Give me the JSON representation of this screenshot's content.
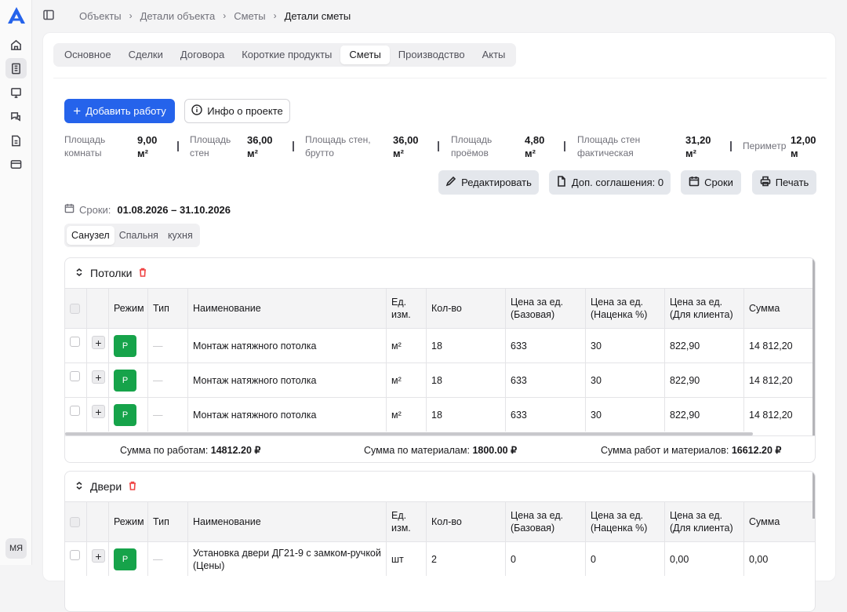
{
  "nav": {
    "avatar": "МЯ"
  },
  "breadcrumb": [
    "Объекты",
    "Детали объекта",
    "Сметы",
    "Детали сметы"
  ],
  "tabs": [
    "Основное",
    "Сделки",
    "Договора",
    "Короткие продукты",
    "Сметы",
    "Производство",
    "Акты"
  ],
  "active_tab": "Сметы",
  "buttons": {
    "add_work": "Добавить работу",
    "project_info": "Инфо о проекте",
    "edit": "Редактировать",
    "addenda": "Доп. соглашения: 0",
    "deadlines": "Сроки",
    "print": "Печать"
  },
  "metrics": [
    {
      "label_1": "Площадь",
      "label_2": "комнаты",
      "val_1": "9,00",
      "val_2": "м²"
    },
    {
      "label_1": "Площадь",
      "label_2": "стен",
      "val_1": "36,00",
      "val_2": "м²"
    },
    {
      "label_1": "Площадь стен,",
      "label_2": "брутто",
      "val_1": "36,00",
      "val_2": "м²"
    },
    {
      "label_1": "Площадь",
      "label_2": "проёмов",
      "val_1": "4,80",
      "val_2": "м²"
    },
    {
      "label_1": "Площадь стен",
      "label_2": "фактическая",
      "val_1": "31,20",
      "val_2": "м²"
    },
    {
      "label_1": "Периметр",
      "label_2": "",
      "val_1": "12,00",
      "val_2": "м"
    }
  ],
  "dates": {
    "label": "Сроки:",
    "value": "01.08.2026 – 31.10.2026"
  },
  "rooms": [
    "Санузел",
    "Спальня",
    "кухня"
  ],
  "columns": [
    {
      "l1": "Режим",
      "l2": ""
    },
    {
      "l1": "Тип",
      "l2": ""
    },
    {
      "l1": "Наименование",
      "l2": ""
    },
    {
      "l1": "Ед.",
      "l2": "изм."
    },
    {
      "l1": "Кол-во",
      "l2": ""
    },
    {
      "l1": "Цена за ед.",
      "l2": "(Базовая)"
    },
    {
      "l1": "Цена за ед.",
      "l2": "(Наценка %)"
    },
    {
      "l1": "Цена за ед.",
      "l2": "(Для клиента)"
    },
    {
      "l1": "Сумма",
      "l2": ""
    }
  ],
  "sections": [
    {
      "title": "Потолки",
      "rows": [
        {
          "mode": "Р",
          "type": "—",
          "name": "Монтаж натяжного потолка",
          "name2": "",
          "unit": "м²",
          "qty": "18",
          "base": "633",
          "markup": "30",
          "client": "822,90",
          "sum": "14 812,20"
        },
        {
          "mode": "Р",
          "type": "—",
          "name": "Монтаж натяжного потолка",
          "name2": "",
          "unit": "м²",
          "qty": "18",
          "base": "633",
          "markup": "30",
          "client": "822,90",
          "sum": "14 812,20"
        },
        {
          "mode": "Р",
          "type": "—",
          "name": "Монтаж натяжного потолка",
          "name2": "",
          "unit": "м²",
          "qty": "18",
          "base": "633",
          "markup": "30",
          "client": "822,90",
          "sum": "14 812,20"
        }
      ],
      "totals": {
        "works_label": "Сумма по работам:",
        "works": "14812.20 ₽",
        "materials_label": "Сумма по материалам:",
        "materials": "1800.00 ₽",
        "all_label": "Сумма работ и материалов:",
        "all": "16612.20 ₽"
      }
    },
    {
      "title": "Двери",
      "rows": [
        {
          "mode": "Р",
          "type": "—",
          "name": "Установка двери ДГ21-9 с замком-ручкой",
          "name2": "(Цены)",
          "unit": "шт",
          "qty": "2",
          "base": "0",
          "markup": "0",
          "client": "0,00",
          "sum": "0,00"
        }
      ]
    }
  ],
  "colors": {
    "primary": "#2563eb",
    "mode_badge": "#16a34a",
    "delete_icon": "#ef4444"
  }
}
